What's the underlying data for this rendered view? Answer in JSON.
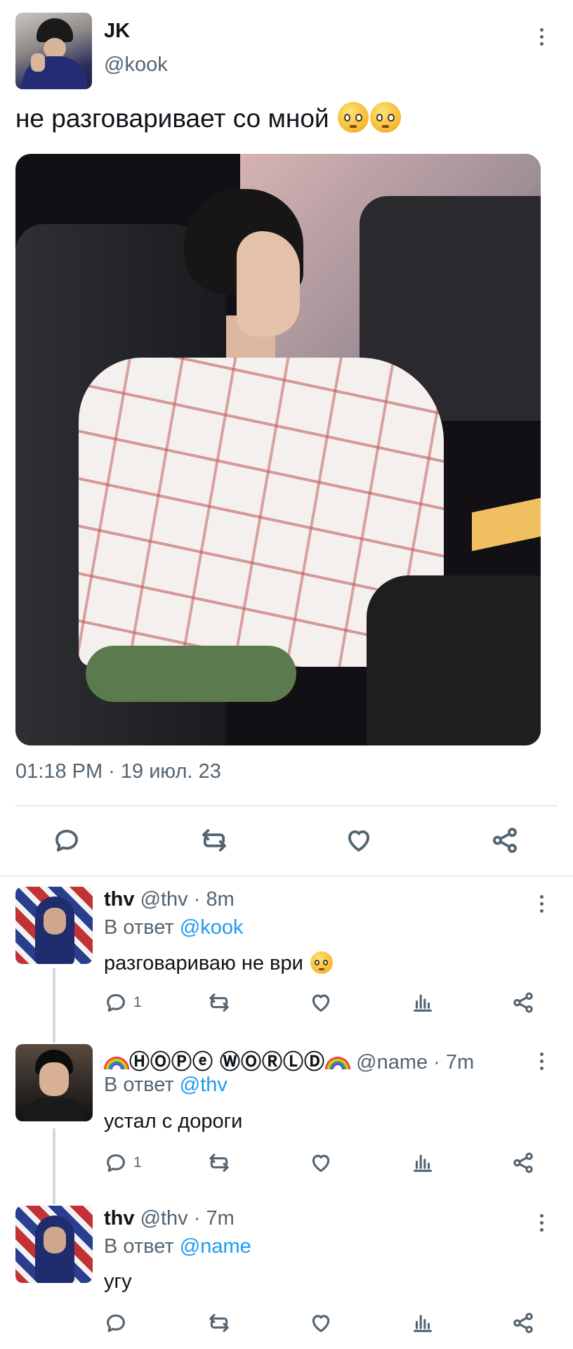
{
  "main_tweet": {
    "author_name": "JK",
    "author_handle": "@kook",
    "text": "не разговаривает со мной",
    "text_emojis": [
      "pleading-face-emoji",
      "holding-back-tears-emoji"
    ],
    "timestamp": "01:18 PM · 19 июл. 23",
    "actions": [
      "reply",
      "retweet",
      "like",
      "share"
    ]
  },
  "replies": [
    {
      "name": "thv",
      "meta": "@thv · 8m",
      "reply_to_prefix": "В ответ",
      "reply_to": "@kook",
      "text": "разговариваю не ври",
      "text_emoji": "raised-eyebrow-face-emoji",
      "reply_count": "1"
    },
    {
      "name": "🄷🄾🄿🄴 🅆🄾🅁🄻🄳",
      "name_display": "ⒽⓄⓅⓔ ⓌⓄⓇⓁⒹ",
      "meta": "@name · 7m",
      "reply_to_prefix": "В ответ",
      "reply_to": "@thv",
      "text": "устал с дороги",
      "reply_count": "1"
    },
    {
      "name": "thv",
      "meta": "@thv · 7m",
      "reply_to_prefix": "В ответ",
      "reply_to": "@name",
      "text": "угу",
      "reply_count": ""
    }
  ],
  "colors": {
    "text": "#0f1419",
    "secondary": "#536471",
    "mention": "#1d9bf0",
    "divider": "#e6e9ec"
  }
}
